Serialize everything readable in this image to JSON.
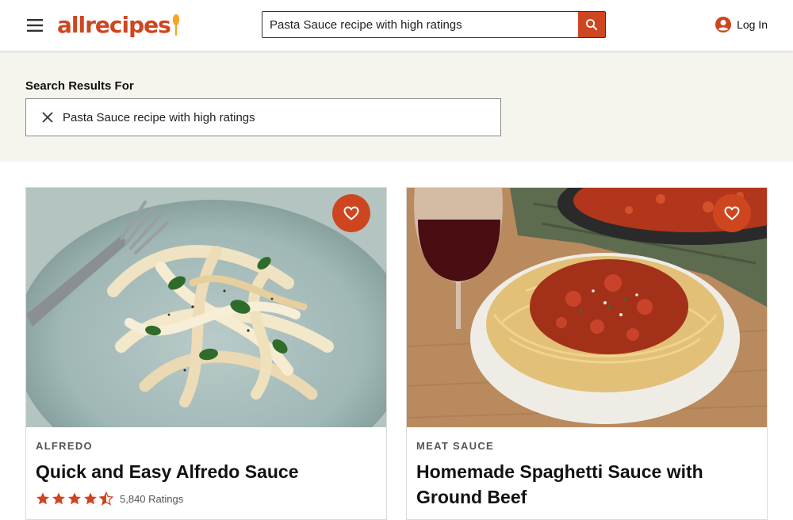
{
  "header": {
    "logo_text": "allrecipes",
    "search": {
      "value": "Pasta Sauce recipe with high ratings",
      "placeholder": ""
    },
    "login_label": "Log In"
  },
  "results": {
    "label": "Search Results For",
    "query": "Pasta Sauce recipe with high ratings"
  },
  "cards": [
    {
      "tag": "ALFREDO",
      "title": "Quick and Easy Alfredo Sauce",
      "stars": 4.5,
      "ratings_text": "5,840 Ratings",
      "image": "fettuccine alfredo on blue plate with fork"
    },
    {
      "tag": "MEAT SAUCE",
      "title": "Homemade Spaghetti Sauce with Ground Beef",
      "image": "spaghetti with meat sauce in bowl, glass of red wine"
    }
  ],
  "colors": {
    "accent": "#ce4620",
    "band": "#f5f5ee"
  },
  "icons": [
    "menu-icon",
    "search-icon",
    "account-icon",
    "close-icon",
    "heart-icon",
    "star-icon"
  ]
}
